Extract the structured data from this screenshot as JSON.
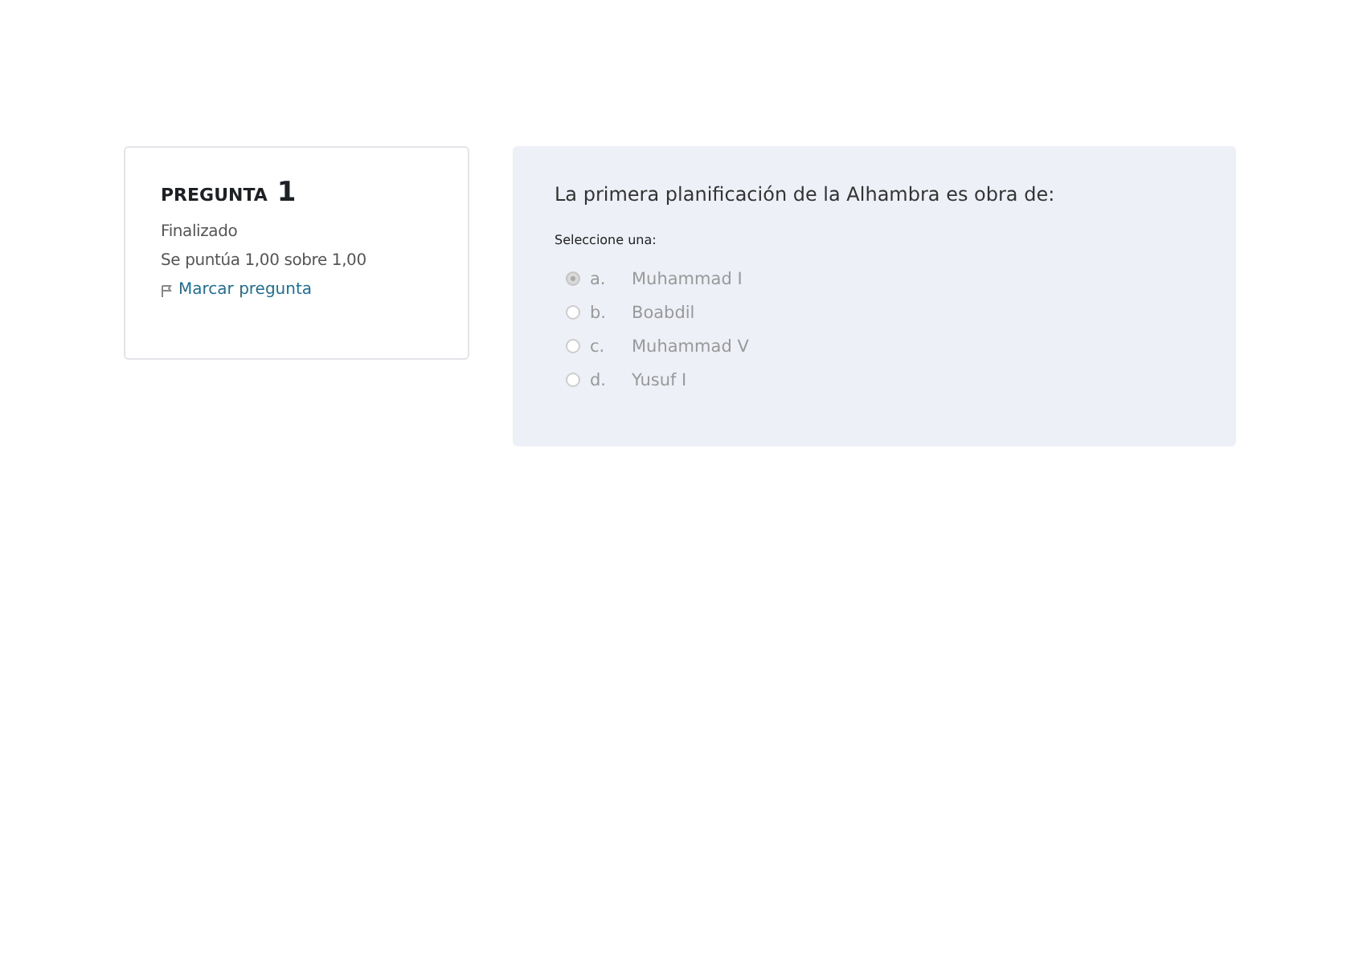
{
  "info": {
    "label": "PREGUNTA",
    "number": "1",
    "state": "Finalizado",
    "grade": "Se puntúa 1,00 sobre 1,00",
    "flag": "Marcar pregunta"
  },
  "question": {
    "text": "La primera planificación de la Alhambra es obra de:",
    "prompt": "Seleccione una:",
    "options": [
      {
        "letter": "a.",
        "text": "Muhammad I",
        "selected": true
      },
      {
        "letter": "b.",
        "text": "Boabdil",
        "selected": false
      },
      {
        "letter": "c.",
        "text": "Muhammad V",
        "selected": false
      },
      {
        "letter": "d.",
        "text": "Yusuf I",
        "selected": false
      }
    ]
  }
}
